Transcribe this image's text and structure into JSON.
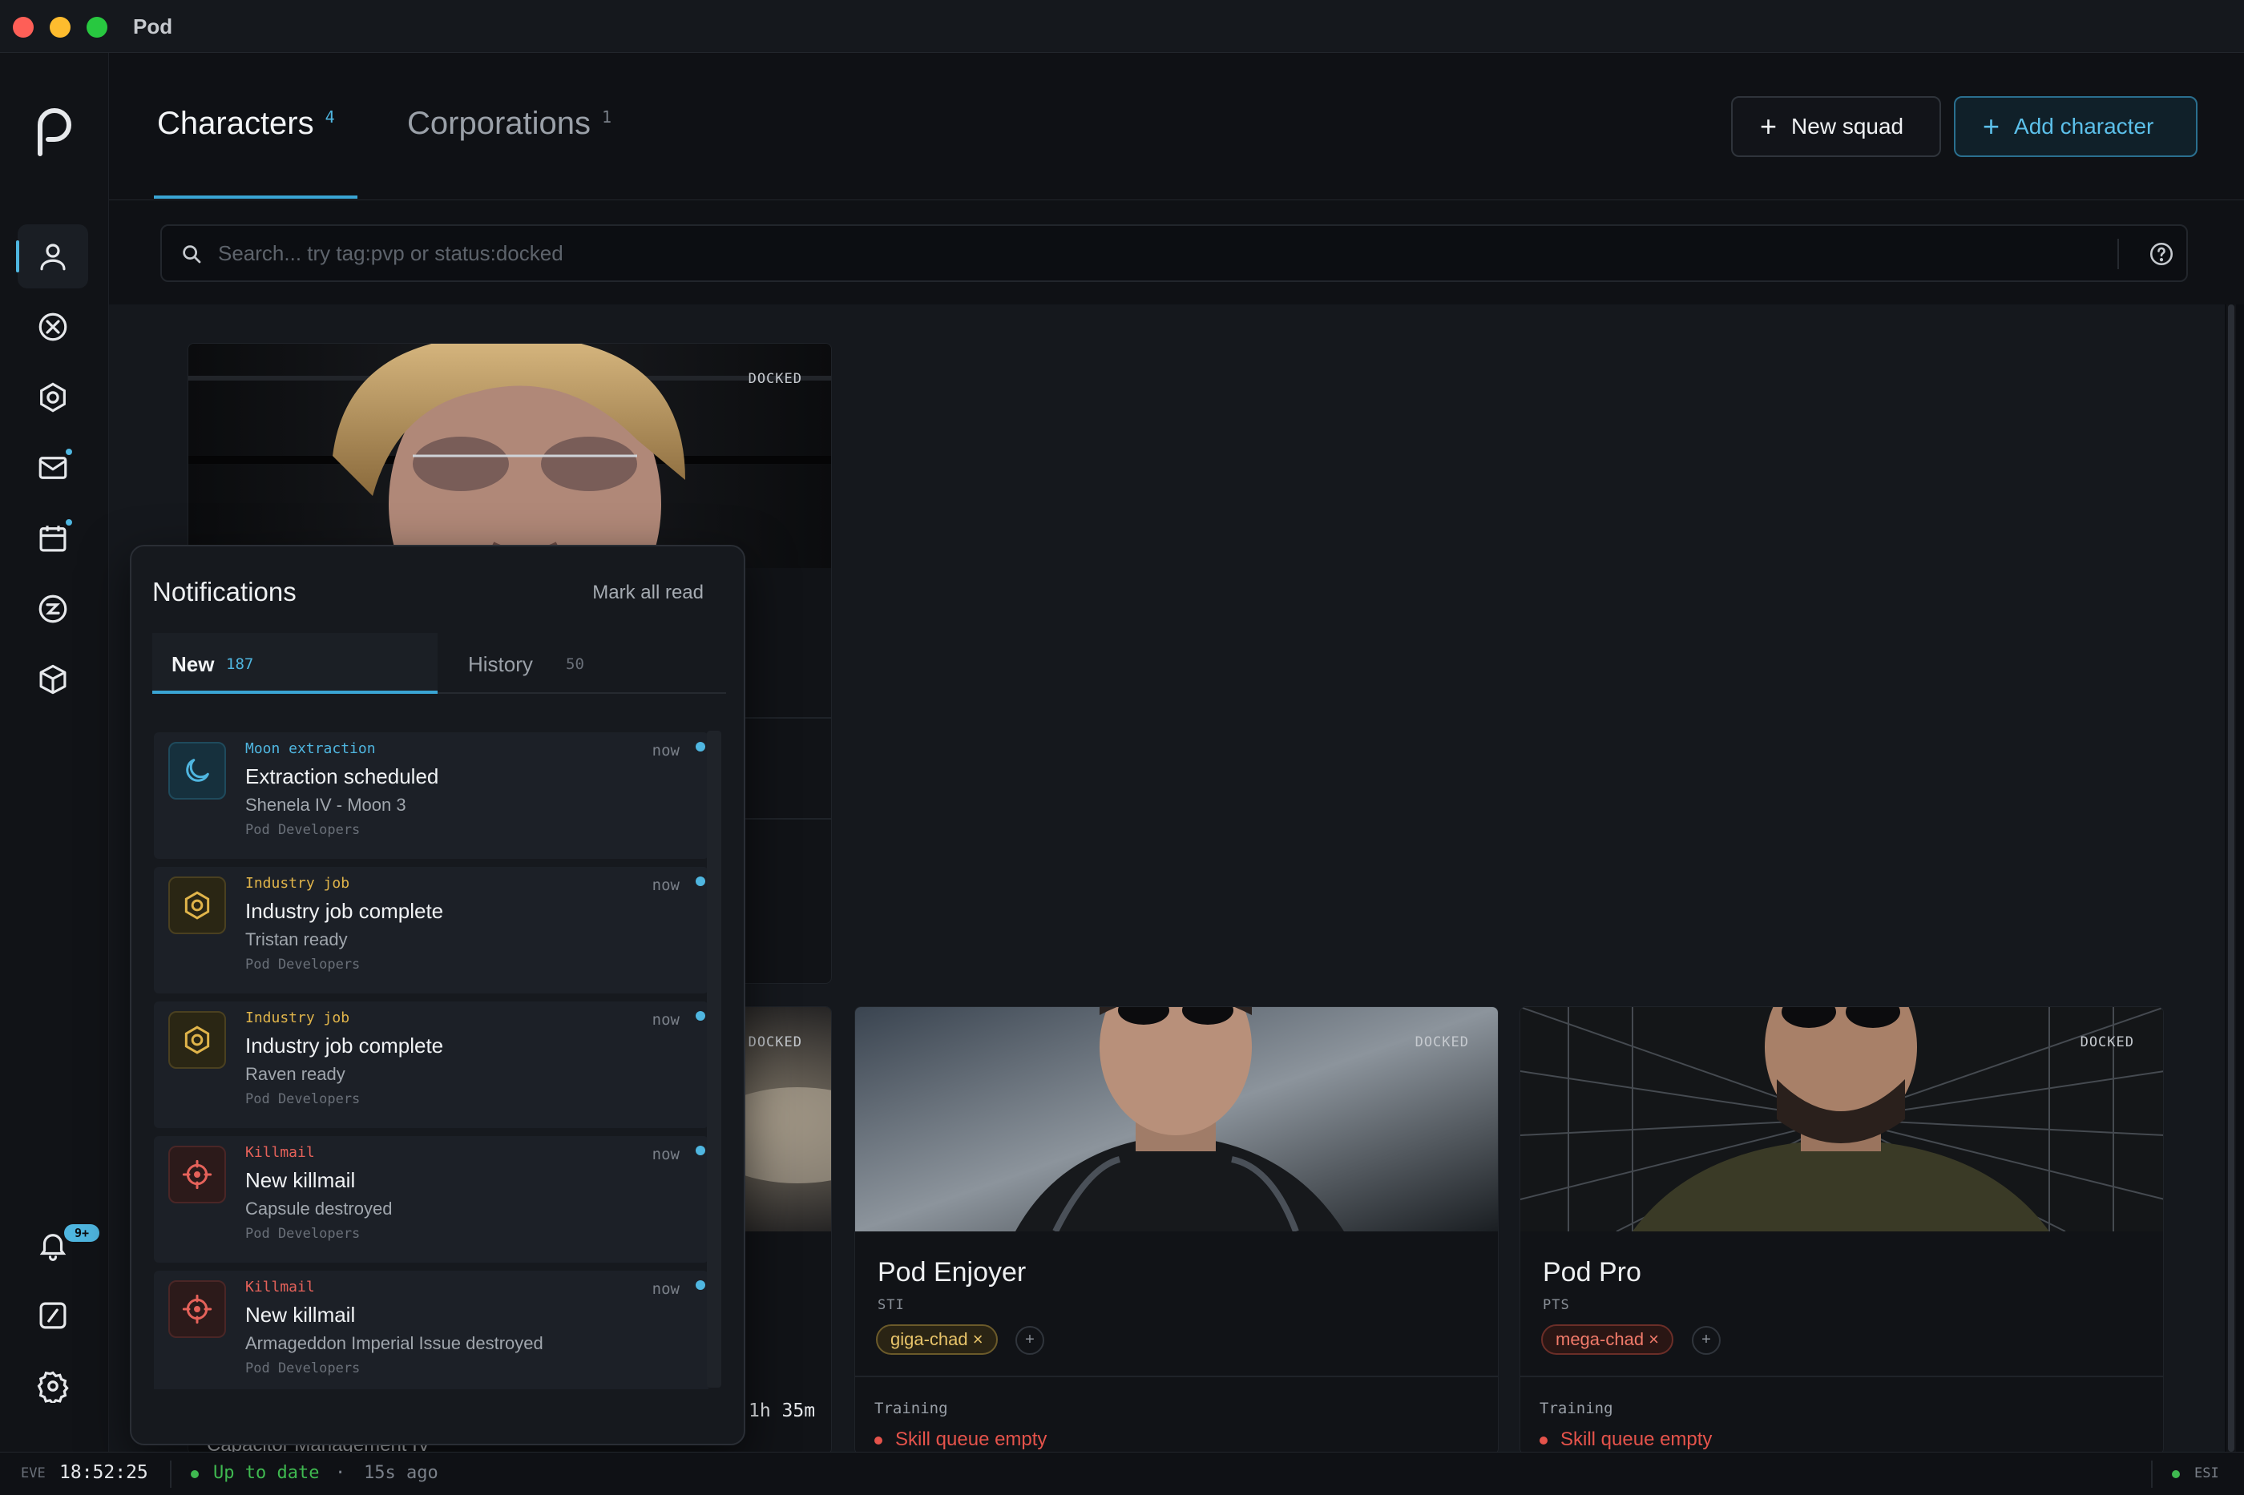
{
  "window": {
    "title": "Pod"
  },
  "header": {
    "tabs": [
      {
        "label": "Characters",
        "count": "4"
      },
      {
        "label": "Corporations",
        "count": "1"
      }
    ],
    "new_squad_label": "New squad",
    "add_character_label": "Add character",
    "plus_glyph": "+"
  },
  "search": {
    "placeholder": "Search... try tag:pvp or status:docked"
  },
  "sidebar": {
    "items": [
      {
        "icon": "user-icon"
      },
      {
        "icon": "x-circle-icon"
      },
      {
        "icon": "hexagon-gear-icon"
      },
      {
        "icon": "mail-icon"
      },
      {
        "icon": "calendar-icon"
      },
      {
        "icon": "isk-icon"
      },
      {
        "icon": "cube-icon"
      }
    ],
    "bottom": [
      {
        "icon": "bell-icon",
        "badge": "9+"
      },
      {
        "icon": "gauge-icon"
      },
      {
        "icon": "settings-icon"
      }
    ]
  },
  "cards": [
    {
      "status": "DOCKED"
    },
    {
      "status": "DOCKED"
    },
    {
      "status": "DOCKED",
      "name": "Pod Enjoyer",
      "ticker": "STI",
      "tag": "giga-chad ×",
      "add_tag": "+",
      "training_label": "Training",
      "skill_queue": "Skill queue empty"
    },
    {
      "status": "DOCKED",
      "name": "Pod Pro",
      "ticker": "PTS",
      "tag": "mega-chad ×",
      "add_tag": "+",
      "training_label": "Training",
      "skill_queue": "Skill queue empty"
    }
  ],
  "background": {
    "time_fragment": "1h 35m",
    "skill_fragment": "Capacitor Management IV"
  },
  "notifications": {
    "title": "Notifications",
    "mark_all_read": "Mark all read",
    "tabs": {
      "new_label": "New",
      "new_count": "187",
      "history_label": "History",
      "history_count": "50"
    },
    "items": [
      {
        "category": "Moon extraction",
        "title": "Extraction scheduled",
        "subtitle": "Shenela IV - Moon 3",
        "org": "Pod Developers",
        "time": "now",
        "kind": "blue"
      },
      {
        "category": "Industry job",
        "title": "Industry job complete",
        "subtitle": "Tristan ready",
        "org": "Pod Developers",
        "time": "now",
        "kind": "yellow"
      },
      {
        "category": "Industry job",
        "title": "Industry job complete",
        "subtitle": "Raven ready",
        "org": "Pod Developers",
        "time": "now",
        "kind": "yellow"
      },
      {
        "category": "Killmail",
        "title": "New killmail",
        "subtitle": "Capsule destroyed",
        "org": "Pod Developers",
        "time": "now",
        "kind": "red"
      },
      {
        "category": "Killmail",
        "title": "New killmail",
        "subtitle": "Armageddon Imperial Issue destroyed",
        "org": "Pod Developers",
        "time": "now",
        "kind": "red"
      }
    ]
  },
  "statusbar": {
    "eve_label": "EVE",
    "clock": "18:52:25",
    "status": "Up to date",
    "sep": "·",
    "ago": "15s ago",
    "esi_label": "ESI"
  },
  "colors": {
    "accent": "#4fb6e0",
    "ok": "#3fb950",
    "danger": "#e5534b",
    "warn": "#e0b44a"
  }
}
